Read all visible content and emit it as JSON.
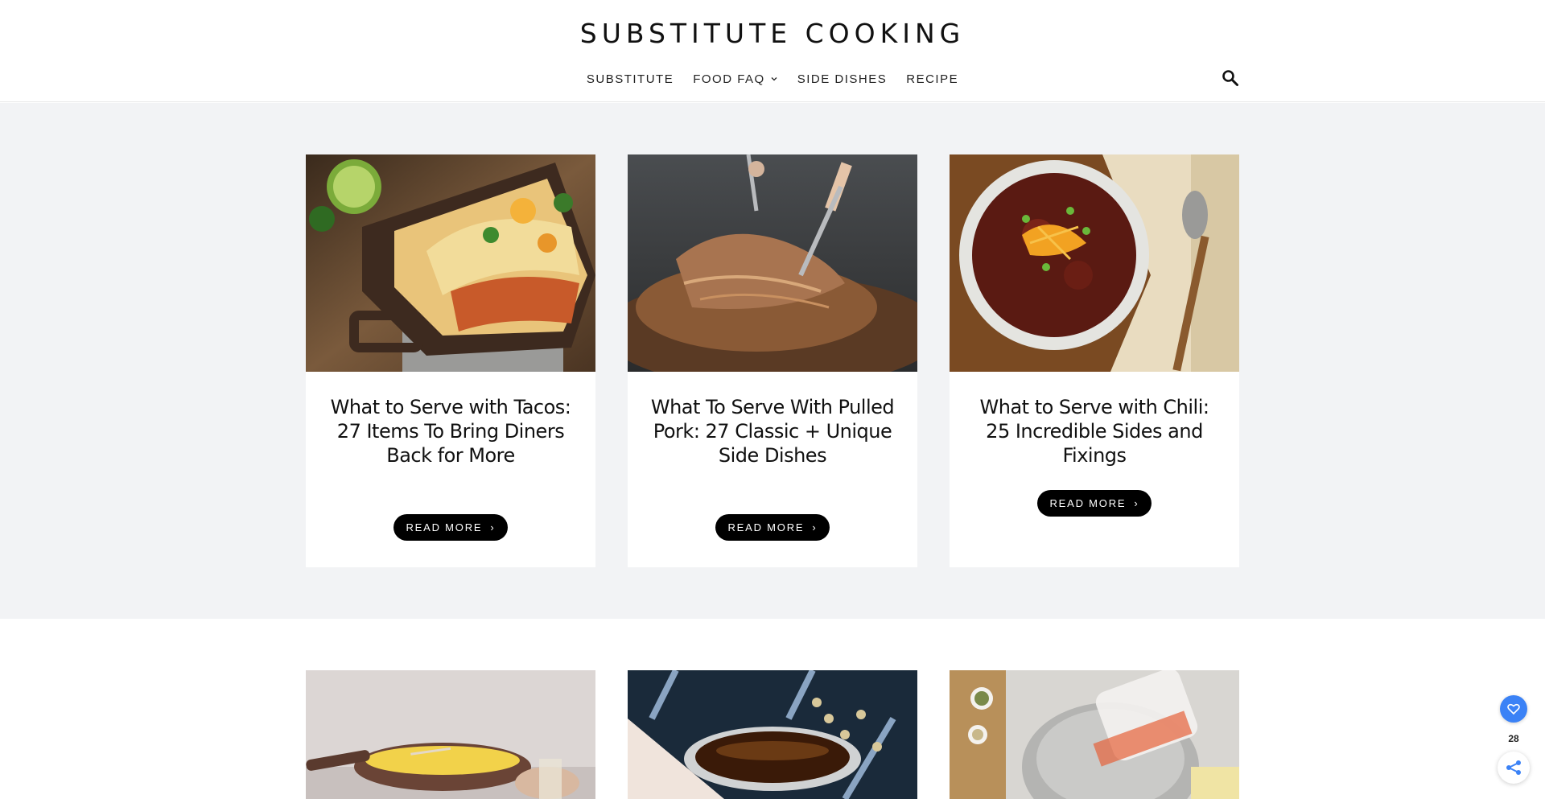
{
  "header": {
    "site_title": "SUBSTITUTE COOKING",
    "nav": [
      {
        "label": "SUBSTITUTE",
        "has_dropdown": false
      },
      {
        "label": "FOOD FAQ",
        "has_dropdown": true
      },
      {
        "label": "SIDE DISHES",
        "has_dropdown": false
      },
      {
        "label": "RECIPE",
        "has_dropdown": false
      }
    ],
    "search_icon": "search-icon"
  },
  "posts_row1": [
    {
      "title": "What to Serve with Tacos: 27 Items To Bring Diners Back for More",
      "button_label": "READ MORE"
    },
    {
      "title": "What To Serve With Pulled Pork: 27 Classic + Unique Side Dishes",
      "button_label": "READ MORE"
    },
    {
      "title": "What to Serve with Chili: 25 Incredible Sides and Fixings",
      "button_label": "READ MORE"
    }
  ],
  "share_widget": {
    "heart_icon": "heart-icon",
    "count": "28",
    "share_icon": "share-icon",
    "accent_color": "#3b82f6"
  },
  "colors": {
    "section_background": "#f2f3f5",
    "button_background": "#000000"
  }
}
